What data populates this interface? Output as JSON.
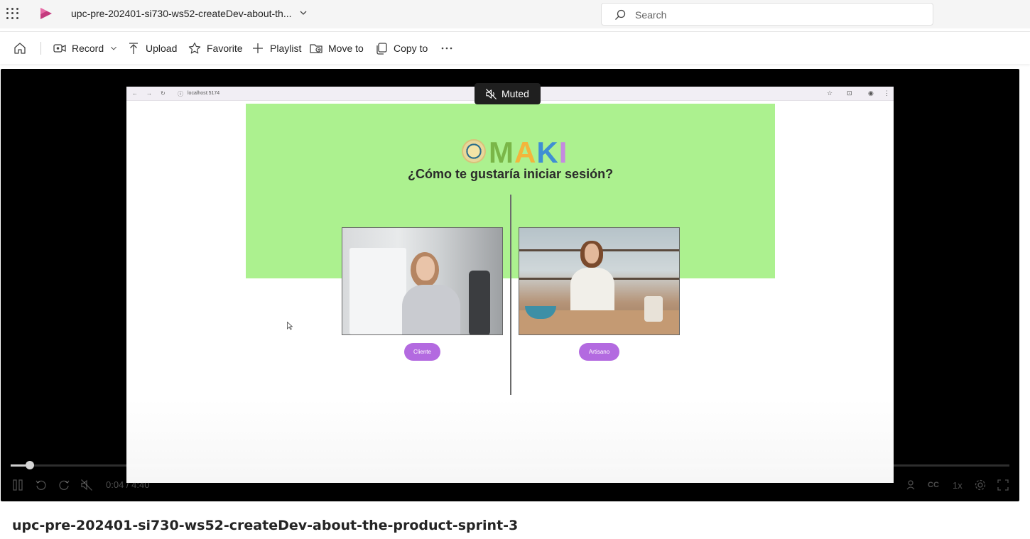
{
  "header": {
    "waffle_icon": "app-launcher-icon",
    "app_logo_icon": "stream-logo-icon",
    "title": "upc-pre-202401-si730-ws52-createDev-about-th...",
    "search_placeholder": "Search",
    "colors": {
      "logo": "#c43a7e",
      "bar_bg": "#f5f5f5"
    }
  },
  "toolbar": {
    "home_icon": "home-icon",
    "record_label": "Record",
    "upload_label": "Upload",
    "favorite_label": "Favorite",
    "playlist_label": "Playlist",
    "move_label": "Move to",
    "copy_label": "Copy to",
    "more_icon": "more-icon"
  },
  "player": {
    "muted_label": "Muted",
    "time_display": "0:04 / 4:40",
    "progress_fraction": 0.015,
    "speed_label": "1x",
    "captions_label": "CC"
  },
  "screen": {
    "url": "localhost:5174",
    "logo_text": [
      "M",
      "A",
      "K",
      "I"
    ],
    "question": "¿Cómo te gustaría iniciar sesión?",
    "client_button": "Cliente",
    "artisan_button": "Artisano",
    "colors": {
      "green": "#acf18f",
      "button": "#b36ae0"
    }
  },
  "video_title": "upc-pre-202401-si730-ws52-createDev-about-the-product-sprint-3"
}
